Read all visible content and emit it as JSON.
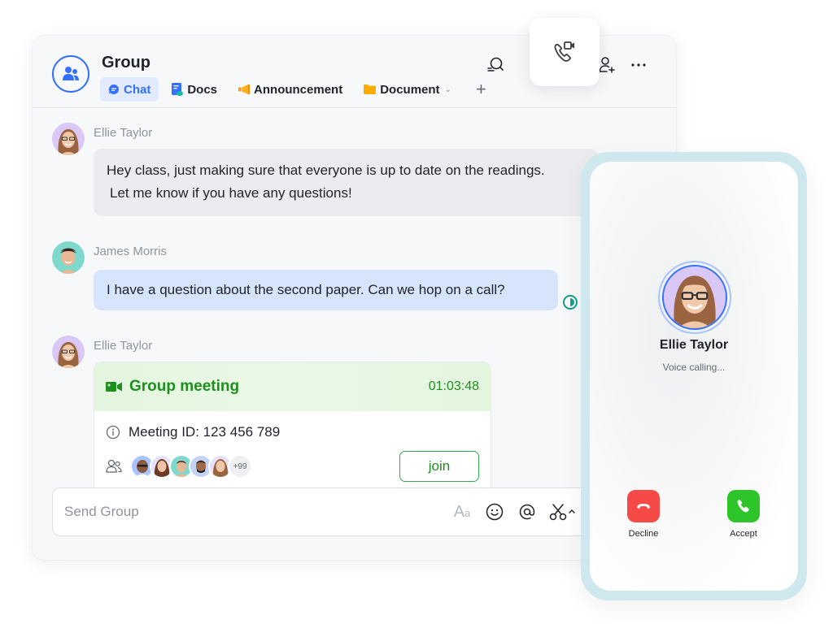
{
  "header": {
    "title": "Group",
    "tabs": [
      {
        "label": "Chat",
        "icon": "chat-bubble-icon",
        "active": true
      },
      {
        "label": "Docs",
        "icon": "docs-icon",
        "active": false
      },
      {
        "label": "Announcement",
        "icon": "megaphone-icon",
        "active": false
      },
      {
        "label": "Document",
        "icon": "folder-icon",
        "active": false,
        "dropdown": true
      }
    ],
    "add_tab_label": "+",
    "icons": [
      "search-icon",
      "video-call-icon",
      "add-user-icon",
      "more-icon"
    ]
  },
  "messages": [
    {
      "sender": "Ellie Taylor",
      "text_line1": "Hey class, just making sure that everyone is up to date on the readings.",
      "text_line2": "Let me know if you have any questions!"
    },
    {
      "sender": "James Morris",
      "text": "I have a question about the second paper. Can we hop on a call?"
    },
    {
      "sender": "Ellie Taylor"
    }
  ],
  "meeting": {
    "title": "Group meeting",
    "duration": "01:03:48",
    "meeting_id": "Meeting ID: 123 456 789",
    "participants_more": "+99",
    "join_label": "join"
  },
  "composer": {
    "placeholder": "Send Group",
    "font_tool_big": "A",
    "font_tool_small": "a"
  },
  "incoming_call": {
    "caller": "Ellie Taylor",
    "status": "Voice calling...",
    "decline_label": "Decline",
    "accept_label": "Accept"
  },
  "colors": {
    "accent": "#3370ff",
    "meeting_green": "#1e8f1e",
    "decline_red": "#f54a45",
    "accept_green": "#2ec52b",
    "status_teal": "#14a085"
  }
}
